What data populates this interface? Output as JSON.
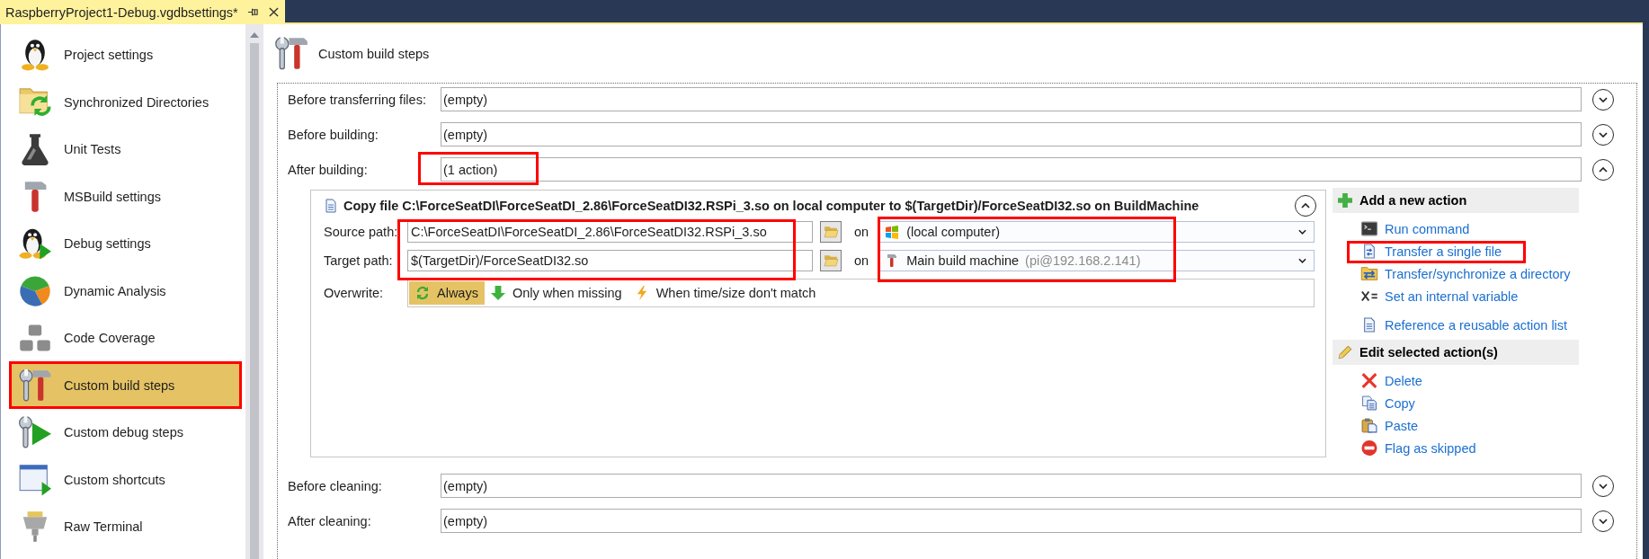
{
  "tab": {
    "title": "RaspberryProject1-Debug.vgdbsettings*"
  },
  "sidebar": {
    "items": [
      {
        "label": "Project settings",
        "selected": false,
        "highlighted": false
      },
      {
        "label": "Synchronized Directories",
        "selected": false,
        "highlighted": false
      },
      {
        "label": "Unit Tests",
        "selected": false,
        "highlighted": false
      },
      {
        "label": "MSBuild settings",
        "selected": false,
        "highlighted": false
      },
      {
        "label": "Debug settings",
        "selected": false,
        "highlighted": false
      },
      {
        "label": "Dynamic Analysis",
        "selected": false,
        "highlighted": false
      },
      {
        "label": "Code Coverage",
        "selected": false,
        "highlighted": false
      },
      {
        "label": "Custom build steps",
        "selected": true,
        "highlighted": true
      },
      {
        "label": "Custom debug steps",
        "selected": false,
        "highlighted": false
      },
      {
        "label": "Custom shortcuts",
        "selected": false,
        "highlighted": false
      },
      {
        "label": "Raw Terminal",
        "selected": false,
        "highlighted": false
      }
    ]
  },
  "page": {
    "title": "Custom build steps"
  },
  "steps": [
    {
      "label": "Before transferring files:",
      "value": "(empty)",
      "expanded": false,
      "highlighted": false
    },
    {
      "label": "Before building:",
      "value": "(empty)",
      "expanded": false,
      "highlighted": false
    },
    {
      "label": "After building:",
      "value": "(1 action)",
      "expanded": true,
      "highlighted": true,
      "actions": [
        {
          "title": "Copy file C:\\ForceSeatDI\\ForceSeatDI_2.86\\ForceSeatDI32.RSPi_3.so on local computer to $(TargetDir)/ForceSeatDI32.so on BuildMachine",
          "expanded": true,
          "paths_highlighted": true,
          "machines_highlighted": true,
          "paths": [
            {
              "label": "Source path:",
              "value": "C:\\ForceSeatDI\\ForceSeatDI_2.86\\ForceSeatDI32.RSPi_3.so",
              "on": "on",
              "machine": "(local computer)"
            },
            {
              "label": "Target path:",
              "value": "$(TargetDir)/ForceSeatDI32.so",
              "on": "on",
              "machine": "Main build machine",
              "machine_detail": "(pi@192.168.2.141)"
            }
          ],
          "overwrite": {
            "label": "Overwrite:",
            "options": [
              {
                "label": "Always",
                "selected": true
              },
              {
                "label": "Only when missing",
                "selected": false
              },
              {
                "label": "When time/size don't match",
                "selected": false
              }
            ]
          }
        }
      ],
      "action_menu": {
        "sections": [
          {
            "title": "Add a new action",
            "groups": [
              {
                "items": [
                  {
                    "label": "Run command",
                    "highlighted": false
                  },
                  {
                    "label": "Transfer a single file",
                    "highlighted": true
                  },
                  {
                    "label": "Transfer/synchronize a directory",
                    "highlighted": false
                  },
                  {
                    "label": "Set an internal variable",
                    "highlighted": false
                  }
                ]
              },
              {
                "items": [
                  {
                    "label": "Reference a reusable action list",
                    "highlighted": false
                  }
                ]
              }
            ]
          },
          {
            "title": "Edit selected action(s)",
            "groups": [
              {
                "items": [
                  {
                    "label": "Delete",
                    "highlighted": false
                  },
                  {
                    "label": "Copy",
                    "highlighted": false
                  },
                  {
                    "label": "Paste",
                    "highlighted": false
                  },
                  {
                    "label": "Flag as skipped",
                    "highlighted": false
                  }
                ]
              }
            ]
          }
        ]
      }
    },
    {
      "label": "Before cleaning:",
      "value": "(empty)",
      "expanded": false,
      "highlighted": false
    },
    {
      "label": "After cleaning:",
      "value": "(empty)",
      "expanded": false,
      "highlighted": false
    }
  ]
}
